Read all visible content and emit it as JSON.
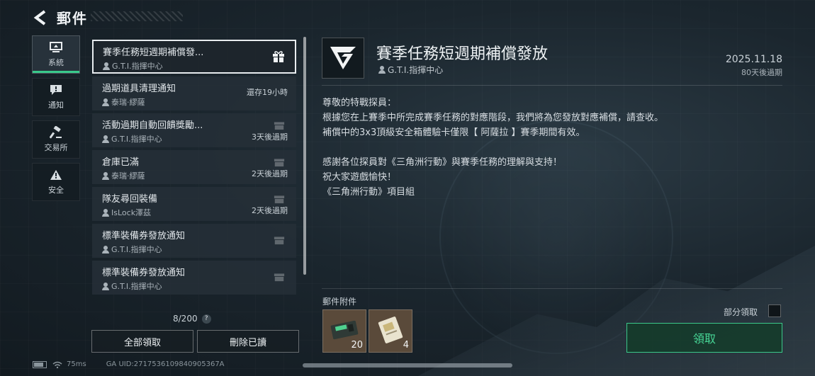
{
  "header": {
    "title": "郵件"
  },
  "nav": [
    {
      "label": "系統",
      "icon": "monitor-icon",
      "active": true
    },
    {
      "label": "通知",
      "icon": "notice-icon",
      "active": false
    },
    {
      "label": "交易所",
      "icon": "hammer-icon",
      "active": false
    },
    {
      "label": "安全",
      "icon": "warning-icon",
      "active": false
    }
  ],
  "mails": [
    {
      "title": "賽季任務短週期補償發...",
      "sender": "G.T.I.指揮中心",
      "status": "",
      "selected": true
    },
    {
      "title": "過期道具清理通知",
      "sender": "泰瑞·繆薩",
      "status": "還存19小時"
    },
    {
      "title": "活動過期自動回饋獎勵...",
      "sender": "G.T.I.指揮中心",
      "status": "3天後過期"
    },
    {
      "title": "倉庫已滿",
      "sender": "泰瑞·繆薩",
      "status": "2天後過期"
    },
    {
      "title": "隊友尋回裝備",
      "sender": "IsLock澤茲",
      "status": "2天後過期"
    },
    {
      "title": "標準裝備券發放通知",
      "sender": "G.T.I.指揮中心",
      "status": ""
    },
    {
      "title": "標準裝備券發放通知",
      "sender": "G.T.I.指揮中心",
      "status": ""
    }
  ],
  "list_footer": {
    "count": "8/200",
    "help": "?"
  },
  "buttons": {
    "claim_all": "全部領取",
    "delete_read": "刪除已讀",
    "claim": "領取"
  },
  "status_bar": {
    "ping": "75ms",
    "uid": "GA UID:2717536109840905367A"
  },
  "detail": {
    "title": "賽季任務短週期補償發放",
    "sender": "G.T.I.指揮中心",
    "date": "2025.11.18",
    "expire": "80天後過期",
    "body": [
      "尊敬的特戰探員：",
      "根據您在上賽季中所完成賽季任務的對應階段，我們將為您發放對應補償，請查收。",
      "補償中的3x3頂級安全箱體驗卡僅限【 阿薩拉 】賽季期間有效。",
      "",
      "感謝各位探員對《三角洲行動》與賽季任務的理解與支持！",
      "祝大家遊戲愉快！",
      "《三角洲行動》項目組"
    ],
    "attachments_label": "郵件附件",
    "attachments": [
      {
        "name": "case-item",
        "qty": "20"
      },
      {
        "name": "card-item",
        "qty": "4"
      }
    ],
    "partial_claim_label": "部分領取"
  },
  "colors": {
    "accent": "#39c98a",
    "claim_text": "#47d696",
    "background": "#1b262e"
  }
}
